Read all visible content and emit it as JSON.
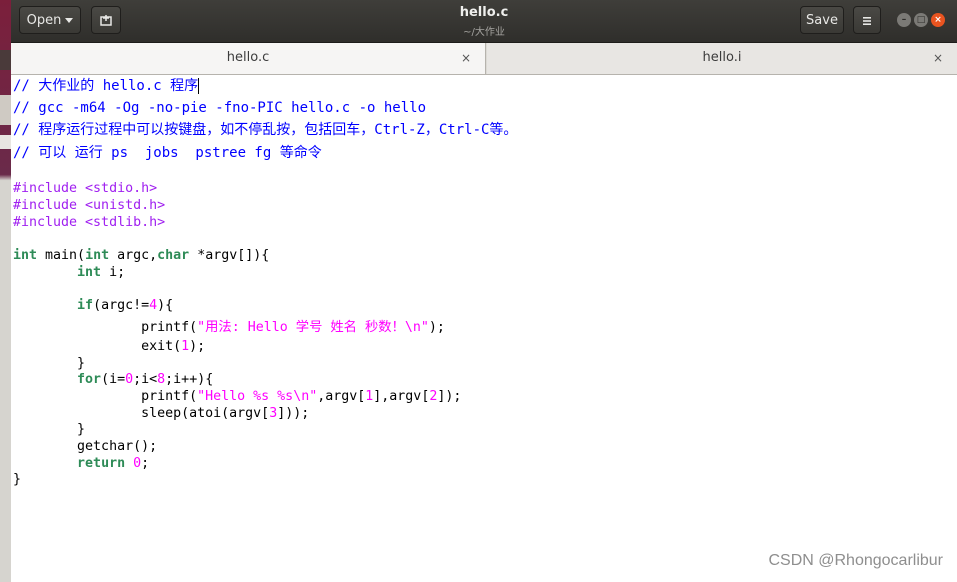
{
  "headerbar": {
    "open_label": "Open",
    "newdoc_icon": "new-document-icon",
    "title": "hello.c",
    "subtitle": "~/大作业",
    "save_label": "Save",
    "menu_icon": "hamburger-menu-icon"
  },
  "tabs": [
    {
      "label": "hello.c",
      "close": "×"
    },
    {
      "label": "hello.i",
      "close": "×"
    }
  ],
  "code_lines": [
    "// 大作业的 hello.c 程序",
    "// gcc -m64 -Og -no-pie -fno-PIC hello.c -o hello",
    "// 程序运行过程中可以按键盘，如不停乱按，包括回车，Ctrl-Z，Ctrl-C等。",
    "// 可以 运行 ps  jobs  pstree fg 等命令",
    "",
    "#include <stdio.h>",
    "#include <unistd.h>",
    "#include <stdlib.h>",
    "",
    "int main(int argc,char *argv[]){",
    "        int i;",
    "",
    "        if(argc!=4){",
    "                printf(\"用法: Hello 学号 姓名 秒数！\\n\");",
    "                exit(1);",
    "        }",
    "        for(i=0;i<8;i++){",
    "                printf(\"Hello %s %s\\n\",argv[1],argv[2]);",
    "                sleep(atoi(argv[3]));",
    "        }",
    "        getchar();",
    "        return 0;",
    "}"
  ],
  "colors": {
    "comment": "#0000ff",
    "preprocessor": "#a020f0",
    "keyword": "#2e8b57",
    "literal": "#ff00ff"
  },
  "watermark": "CSDN @Rhongocarlibur"
}
